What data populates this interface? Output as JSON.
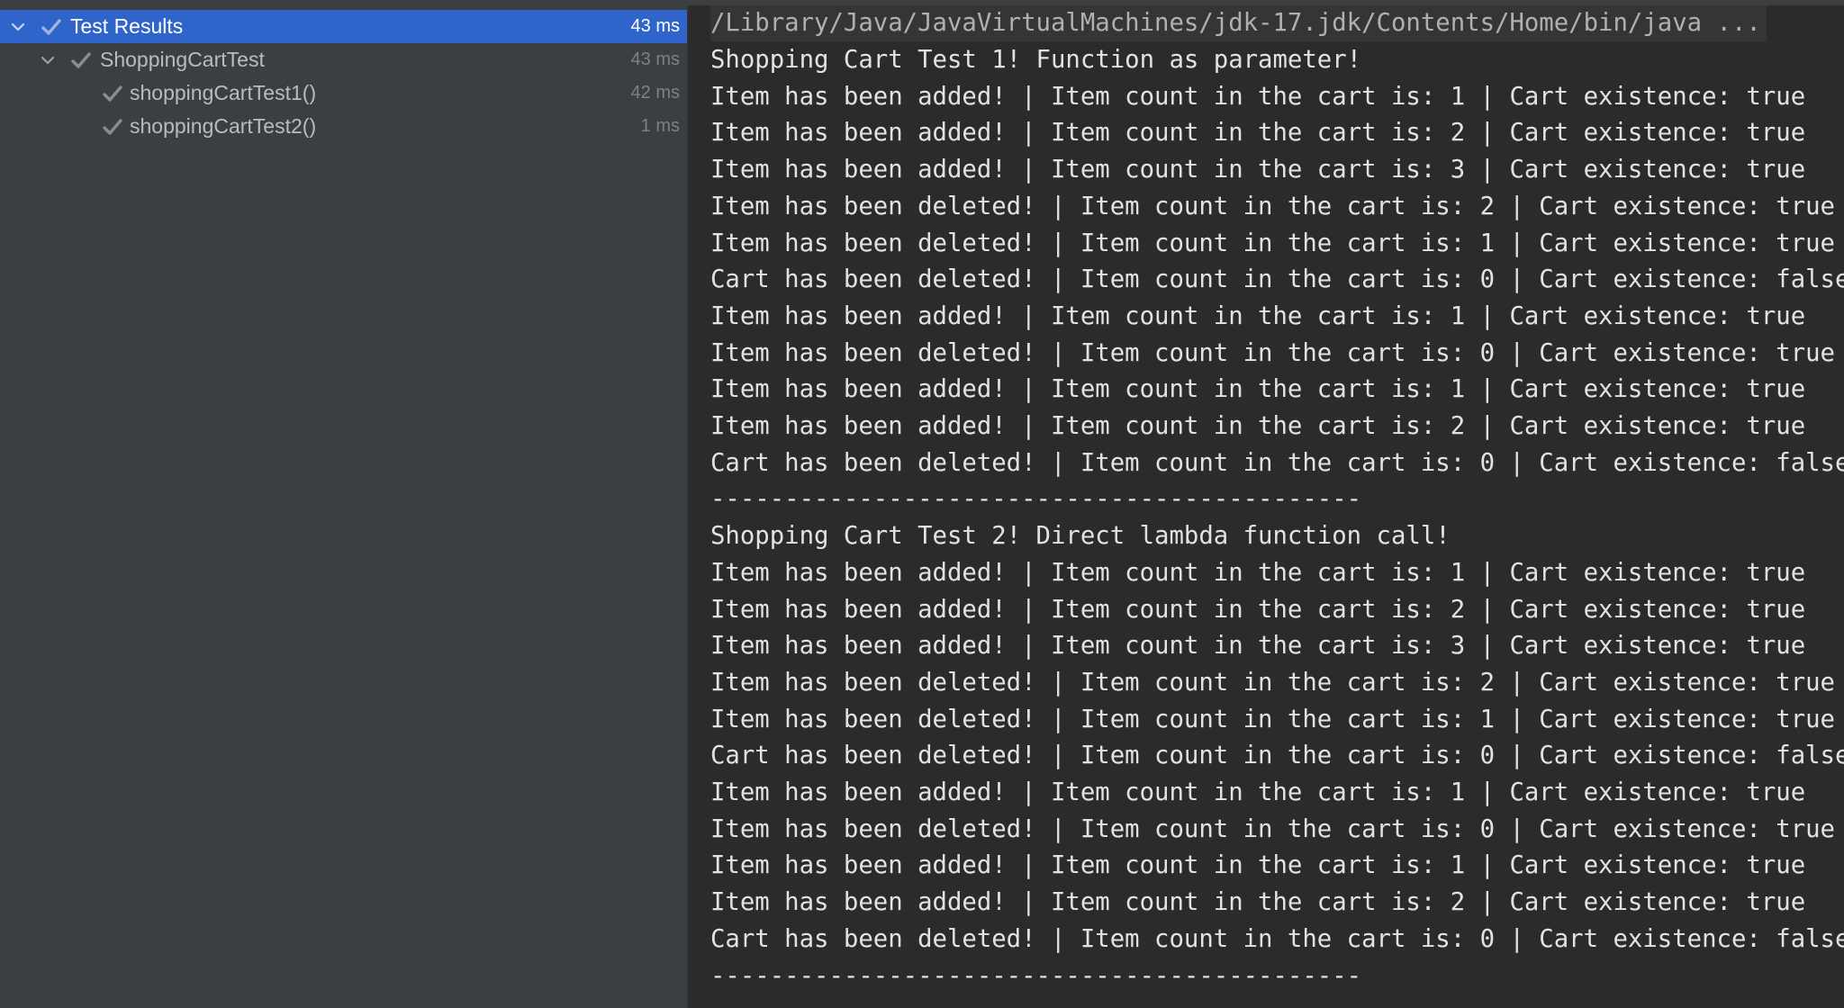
{
  "test_tree": {
    "root": {
      "label": "Test Results",
      "time": "43 ms",
      "status": "passed"
    },
    "class": {
      "label": "ShoppingCartTest",
      "time": "43 ms",
      "status": "passed"
    },
    "tests": [
      {
        "label": "shoppingCartTest1()",
        "time": "42 ms",
        "status": "passed"
      },
      {
        "label": "shoppingCartTest2()",
        "time": "1 ms",
        "status": "passed"
      }
    ],
    "icons": {
      "expand": "chevron-down-icon",
      "passed": "check-icon"
    }
  },
  "console": {
    "command": "/Library/Java/JavaVirtualMachines/jdk-17.jdk/Contents/Home/bin/java ...",
    "lines": [
      "Shopping Cart Test 1! Function as parameter!",
      "Item has been added! | Item count in the cart is: 1 | Cart existence: true",
      "Item has been added! | Item count in the cart is: 2 | Cart existence: true",
      "Item has been added! | Item count in the cart is: 3 | Cart existence: true",
      "Item has been deleted! | Item count in the cart is: 2 | Cart existence: true",
      "Item has been deleted! | Item count in the cart is: 1 | Cart existence: true",
      "Cart has been deleted! | Item count in the cart is: 0 | Cart existence: false",
      "Item has been added! | Item count in the cart is: 1 | Cart existence: true",
      "Item has been deleted! | Item count in the cart is: 0 | Cart existence: true",
      "Item has been added! | Item count in the cart is: 1 | Cart existence: true",
      "Item has been added! | Item count in the cart is: 2 | Cart existence: true",
      "Cart has been deleted! | Item count in the cart is: 0 | Cart existence: false",
      "--------------------------------------------",
      "Shopping Cart Test 2! Direct lambda function call!",
      "Item has been added! | Item count in the cart is: 1 | Cart existence: true",
      "Item has been added! | Item count in the cart is: 2 | Cart existence: true",
      "Item has been added! | Item count in the cart is: 3 | Cart existence: true",
      "Item has been deleted! | Item count in the cart is: 2 | Cart existence: true",
      "Item has been deleted! | Item count in the cart is: 1 | Cart existence: true",
      "Cart has been deleted! | Item count in the cart is: 0 | Cart existence: false",
      "Item has been added! | Item count in the cart is: 1 | Cart existence: true",
      "Item has been deleted! | Item count in the cart is: 0 | Cart existence: true",
      "Item has been added! | Item count in the cart is: 1 | Cart existence: true",
      "Item has been added! | Item count in the cart is: 2 | Cart existence: true",
      "Cart has been deleted! | Item count in the cart is: 0 | Cart existence: false",
      "--------------------------------------------"
    ]
  },
  "colors": {
    "selection": "#2f65ca",
    "panel_bg": "#3c3f41",
    "console_bg": "#2b2b2b",
    "check": "#9a9a9a"
  }
}
